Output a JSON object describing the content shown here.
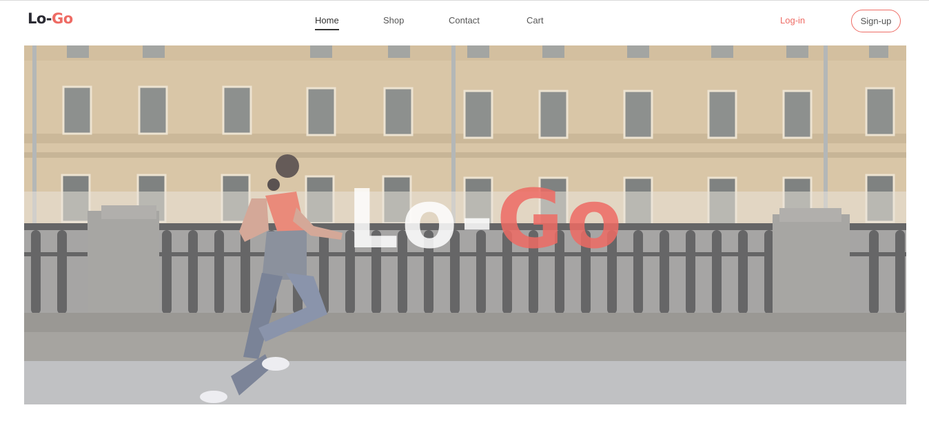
{
  "brand": {
    "part1": "Lo-",
    "part2": "Go"
  },
  "nav": {
    "items": [
      {
        "label": "Home",
        "active": true
      },
      {
        "label": "Shop",
        "active": false
      },
      {
        "label": "Contact",
        "active": false
      },
      {
        "label": "Cart",
        "active": false
      }
    ]
  },
  "auth": {
    "login_label": "Log-in",
    "signup_label": "Sign-up"
  },
  "hero": {
    "title_part1": "Lo-",
    "title_part2": "Go",
    "image_description_icon": "runner-photo"
  },
  "colors": {
    "accent": "#ee6b64",
    "text_dark": "#2b2b33",
    "nav_text": "#555555"
  }
}
